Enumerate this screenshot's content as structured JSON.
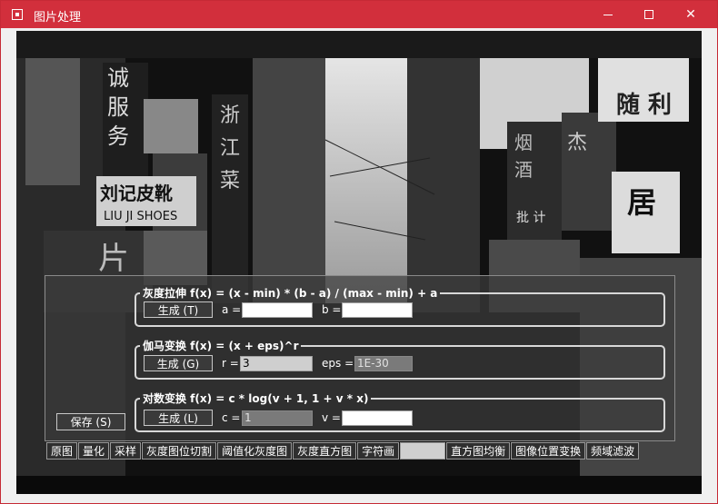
{
  "window": {
    "title": "图片处理",
    "minimize_glyph": "—",
    "maximize_glyph": "☐",
    "close_glyph": "✕"
  },
  "image": {
    "signs": [
      "诚",
      "服",
      "务",
      "浙",
      "江",
      "菜",
      "刘记皮靴",
      "LIU JI SHOES",
      "随 利",
      "居",
      "片",
      "杰",
      "烟",
      "酒",
      "批 计"
    ]
  },
  "stretch": {
    "legend": "灰度拉伸 f(x) = (x - min) * (b - a) / (max - min) + a",
    "button": "生成 (T)",
    "a_label": "a =",
    "a_value": "",
    "b_label": "b =",
    "b_value": ""
  },
  "gamma": {
    "legend": "伽马变换 f(x) = (x + eps)^r",
    "button": "生成 (G)",
    "r_label": "r =",
    "r_value": "3",
    "eps_label": "eps =",
    "eps_value": "1E-30"
  },
  "log": {
    "legend": "对数变换 f(x) = c * log(v + 1, 1 + v * x)",
    "button": "生成 (L)",
    "c_label": "c =",
    "c_value": "1",
    "v_label": "v =",
    "v_value": ""
  },
  "save_button": "保存 (S)",
  "tabs": [
    "原图",
    "量化",
    "采样",
    "灰度图位切割",
    "阈值化灰度图",
    "灰度直方图",
    "字符画",
    "",
    "直方图均衡",
    "图像位置变换",
    "频域滤波"
  ]
}
